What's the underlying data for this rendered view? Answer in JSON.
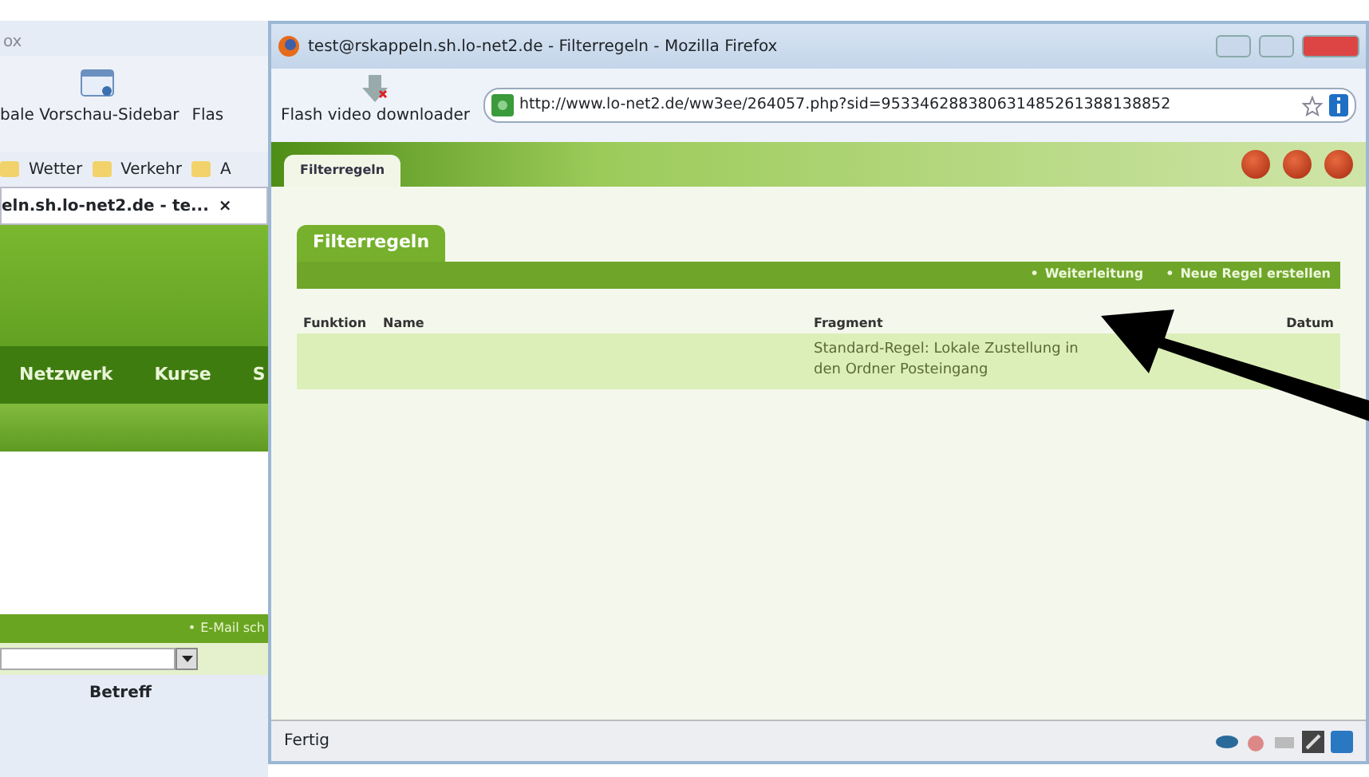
{
  "background_window": {
    "title": "ox",
    "toolbar_items": [
      "bale Vorschau-Sidebar",
      "Flas"
    ],
    "bookmarks": [
      "Wetter",
      "Verkehr",
      "A"
    ],
    "tab": {
      "title": "eln.sh.lo-net2.de - te...",
      "close": "×"
    },
    "nav": [
      "Netzwerk",
      "Kurse",
      "S"
    ],
    "mail_bar": {
      "bullet": "•",
      "label": "E-Mail sch"
    },
    "column_header": "Betreff"
  },
  "window": {
    "title": "test@rskappeln.sh.lo-net2.de - Filterregeln - Mozilla Firefox",
    "toolbar": {
      "label": "Flash video downloader"
    },
    "url": "http://www.lo-net2.de/ww3ee/264057.php?sid=953346288380631485261388138852",
    "page": {
      "tabs": [
        {
          "label": "Filterregeln",
          "selected": true
        }
      ],
      "heading": "Filterregeln",
      "actions": [
        {
          "bullet": "•",
          "label": "Weiterleitung"
        },
        {
          "bullet": "•",
          "label": "Neue Regel erstellen"
        }
      ],
      "table": {
        "columns": [
          "Funktion",
          "Name",
          "Fragment",
          "Datum"
        ],
        "rows": [
          [
            "",
            "",
            "Standard-Regel: Lokale Zustellung in den Ordner Posteingang",
            ""
          ]
        ]
      }
    },
    "status_bar": "Fertig"
  }
}
